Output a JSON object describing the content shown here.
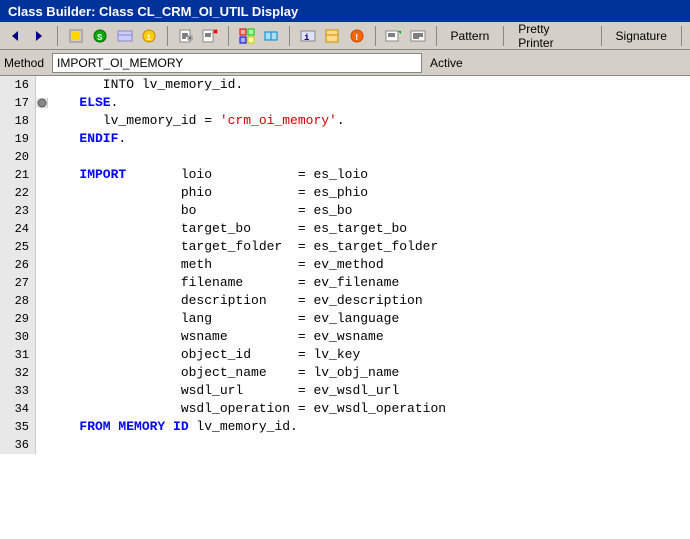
{
  "title": "Class Builder: Class CL_CRM_OI_UTIL Display",
  "toolbar": {
    "pattern_label": "Pattern",
    "pretty_printer_label": "Pretty Printer",
    "signature_label": "Signature"
  },
  "method_bar": {
    "method_label": "Method",
    "method_value": "IMPORT_OI_MEMORY",
    "active_label": "Active"
  },
  "code_lines": [
    {
      "num": "16",
      "breakpoint": false,
      "content": "      INTO lv_memory_id.",
      "parts": [
        {
          "text": "      INTO lv_memory_id.",
          "class": "normal"
        }
      ]
    },
    {
      "num": "17",
      "breakpoint": true,
      "content": "   ELSE.",
      "parts": [
        {
          "text": "   ",
          "class": "normal"
        },
        {
          "text": "ELSE",
          "class": "kw-blue"
        },
        {
          "text": ".",
          "class": "normal"
        }
      ]
    },
    {
      "num": "18",
      "breakpoint": false,
      "content": "      lv_memory_id = 'crm_oi_memory'.",
      "parts": [
        {
          "text": "      lv_memory_id = ",
          "class": "normal"
        },
        {
          "text": "'crm_oi_memory'",
          "class": "str-red"
        },
        {
          "text": ".",
          "class": "normal"
        }
      ]
    },
    {
      "num": "19",
      "breakpoint": false,
      "content": "   ENDIF.",
      "parts": [
        {
          "text": "   ",
          "class": "normal"
        },
        {
          "text": "ENDIF",
          "class": "kw-blue"
        },
        {
          "text": ".",
          "class": "normal"
        }
      ]
    },
    {
      "num": "20",
      "breakpoint": false,
      "content": "",
      "parts": []
    },
    {
      "num": "21",
      "breakpoint": false,
      "content": "   IMPORT       loio           = es_loio",
      "parts": [
        {
          "text": "   ",
          "class": "normal"
        },
        {
          "text": "IMPORT",
          "class": "kw-blue"
        },
        {
          "text": "       loio           = es_loio",
          "class": "normal"
        }
      ]
    },
    {
      "num": "22",
      "breakpoint": false,
      "content": "                phio           = es_phio",
      "parts": [
        {
          "text": "                phio           = es_phio",
          "class": "normal"
        }
      ]
    },
    {
      "num": "23",
      "breakpoint": false,
      "content": "                bo             = es_bo",
      "parts": [
        {
          "text": "                bo             = es_bo",
          "class": "normal"
        }
      ]
    },
    {
      "num": "24",
      "breakpoint": false,
      "content": "                target_bo      = es_target_bo",
      "parts": [
        {
          "text": "                target_bo      = es_target_bo",
          "class": "normal"
        }
      ]
    },
    {
      "num": "25",
      "breakpoint": false,
      "content": "                target_folder  = es_target_folder",
      "parts": [
        {
          "text": "                target_folder  = es_target_folder",
          "class": "normal"
        }
      ]
    },
    {
      "num": "26",
      "breakpoint": false,
      "content": "                meth           = ev_method",
      "parts": [
        {
          "text": "                meth           = ev_method",
          "class": "normal"
        }
      ]
    },
    {
      "num": "27",
      "breakpoint": false,
      "content": "                filename       = ev_filename",
      "parts": [
        {
          "text": "                filename       = ev_filename",
          "class": "normal"
        }
      ]
    },
    {
      "num": "28",
      "breakpoint": false,
      "content": "                description    = ev_description",
      "parts": [
        {
          "text": "                description    = ev_description",
          "class": "normal"
        }
      ]
    },
    {
      "num": "29",
      "breakpoint": false,
      "content": "                lang           = ev_language",
      "parts": [
        {
          "text": "                lang           = ev_language",
          "class": "normal"
        }
      ]
    },
    {
      "num": "30",
      "breakpoint": false,
      "content": "                wsname         = ev_wsname",
      "parts": [
        {
          "text": "                wsname         = ev_wsname",
          "class": "normal"
        }
      ]
    },
    {
      "num": "31",
      "breakpoint": false,
      "content": "                object_id      = lv_key",
      "parts": [
        {
          "text": "                object_id      = lv_key",
          "class": "normal"
        }
      ]
    },
    {
      "num": "32",
      "breakpoint": false,
      "content": "                object_name    = lv_obj_name",
      "parts": [
        {
          "text": "                object_name    = lv_obj_name",
          "class": "normal"
        }
      ]
    },
    {
      "num": "33",
      "breakpoint": false,
      "content": "                wsdl_url       = ev_wsdl_url",
      "parts": [
        {
          "text": "                wsdl_url       = ev_wsdl_url",
          "class": "normal"
        }
      ]
    },
    {
      "num": "34",
      "breakpoint": false,
      "content": "                wsdl_operation = ev_wsdl_operation",
      "parts": [
        {
          "text": "                wsdl_operation = ev_wsdl_operation",
          "class": "normal"
        }
      ]
    },
    {
      "num": "35",
      "breakpoint": false,
      "content": "   FROM MEMORY ID lv_memory_id.",
      "parts": [
        {
          "text": "   ",
          "class": "normal"
        },
        {
          "text": "FROM MEMORY ID",
          "class": "kw-blue"
        },
        {
          "text": " lv_memory_id.",
          "class": "normal"
        }
      ]
    },
    {
      "num": "36",
      "breakpoint": false,
      "content": "",
      "parts": []
    }
  ]
}
